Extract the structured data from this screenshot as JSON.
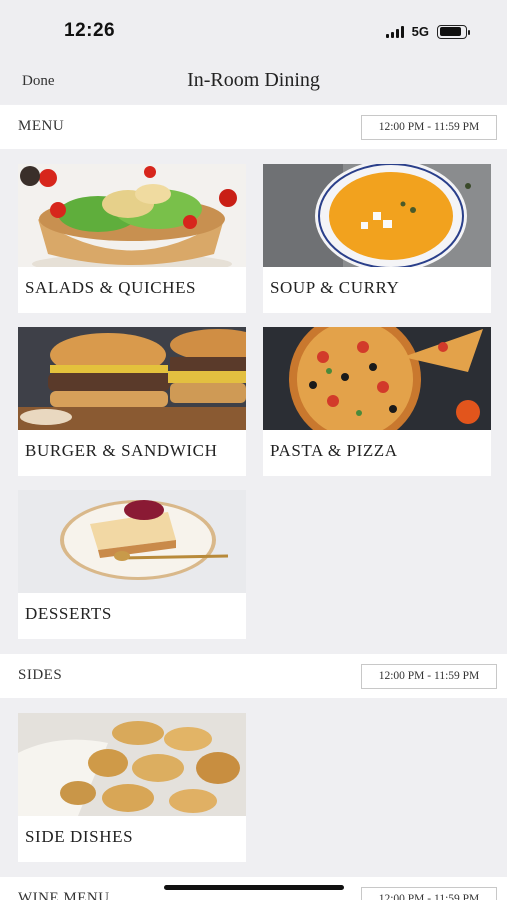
{
  "status": {
    "time": "12:26",
    "network": "5G"
  },
  "nav": {
    "done_label": "Done",
    "title": "In-Room Dining"
  },
  "sections": [
    {
      "title": "MENU",
      "hours": "12:00 PM - 11:59 PM",
      "items": [
        "SALADS & QUICHES",
        "SOUP & CURRY",
        "BURGER & SANDWICH",
        "PASTA & PIZZA",
        "DESSERTS"
      ]
    },
    {
      "title": "SIDES",
      "hours": "12:00 PM - 11:59 PM",
      "items": [
        "SIDE DISHES"
      ]
    },
    {
      "title": "WINE MENU",
      "hours": "12:00 PM - 11:59 PM"
    }
  ]
}
